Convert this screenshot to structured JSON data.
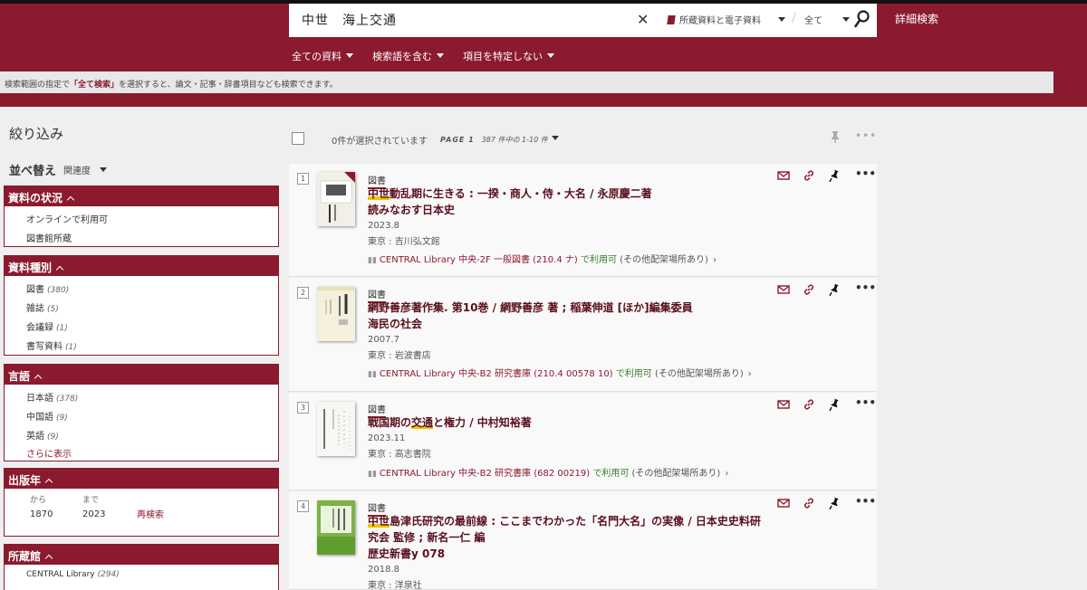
{
  "search": {
    "query": "中世　海上交通",
    "scope1": "所蔵資料と電子資料",
    "scope2": "全て",
    "advanced": "詳細検索"
  },
  "subnav": [
    "全ての資料",
    "検索語を含む",
    "項目を特定しない"
  ],
  "notice": {
    "pre": "検索範囲の指定で",
    "bold": "「全て検索」",
    "post": "を選択すると、論文・記事・辞書項目なども検索できます。"
  },
  "sidebar": {
    "refine_title": "絞り込み",
    "sort_label": "並べ替え",
    "sort_value": "関連度",
    "facets": [
      {
        "title": "資料の状況",
        "items": [
          {
            "label": "オンラインで利用可",
            "count": ""
          },
          {
            "label": "図書館所蔵",
            "count": ""
          }
        ]
      },
      {
        "title": "資料種別",
        "items": [
          {
            "label": "図書",
            "count": "(380)"
          },
          {
            "label": "雑誌",
            "count": "(5)"
          },
          {
            "label": "会議録",
            "count": "(1)"
          },
          {
            "label": "書写資料",
            "count": "(1)"
          }
        ]
      },
      {
        "title": "言語",
        "items": [
          {
            "label": "日本語",
            "count": "(378)"
          },
          {
            "label": "中国語",
            "count": "(9)"
          },
          {
            "label": "英語",
            "count": "(9)"
          }
        ],
        "more": "さらに表示"
      },
      {
        "title": "出版年",
        "from_label": "から",
        "to_label": "まで",
        "from": "1870",
        "to": "2023",
        "research": "再検索"
      },
      {
        "title": "所蔵館",
        "items": [
          {
            "label": "CENTRAL Library",
            "count": "(294)"
          }
        ]
      }
    ]
  },
  "results_header": {
    "selected": "0件が選択されています",
    "page": "PAGE 1",
    "range": "387 件中の 1-10 件"
  },
  "results": [
    {
      "num": "1",
      "type": "図書",
      "title_pre": "",
      "title_hl": "中世",
      "title_post": "動乱期に生きる : 一揆・商人・侍・大名 / 永原慶二著",
      "title2": "読みなおす日本史",
      "date": "2023.8",
      "publisher": "東京 : 吉川弘文館",
      "location": "CENTRAL Library 中央-2F 一般図書 (210.4 ナ)",
      "status": "で利用可",
      "other": "(その他配架場所あり)"
    },
    {
      "num": "2",
      "type": "図書",
      "title_pre": "",
      "title_hl": "",
      "title_post": "網野善彦著作集. 第10巻 / 網野善彦 著 ; 稲葉伸道 [ほか]編集委員",
      "title2": "海民の社会",
      "date": "2007.7",
      "publisher": "東京 : 岩波書店",
      "location": "CENTRAL Library 中央-B2 研究書庫 (210.4 00578 10)",
      "status": "で利用可",
      "other": "(その他配架場所あり)"
    },
    {
      "num": "3",
      "type": "図書",
      "title_pre": "戦国期の",
      "title_hl": "交通",
      "title_post": "と権力 / 中村知裕著",
      "title2": "",
      "date": "2023.11",
      "publisher": "東京 : 高志書院",
      "location": "CENTRAL Library 中央-B2 研究書庫 (682 00219)",
      "status": "で利用可",
      "other": "(その他配架場所あり)"
    },
    {
      "num": "4",
      "type": "図書",
      "title_pre": "",
      "title_hl": "中世",
      "title_post": "島津氏研究の最前線 : ここまでわかった「名門大名」の実像 / 日本史史料研究会 監修 ; 新名一仁 編",
      "title2": "歴史新書y 078",
      "date": "2018.8",
      "publisher": "東京 : 洋泉社",
      "location": "",
      "status": "",
      "other": ""
    }
  ]
}
